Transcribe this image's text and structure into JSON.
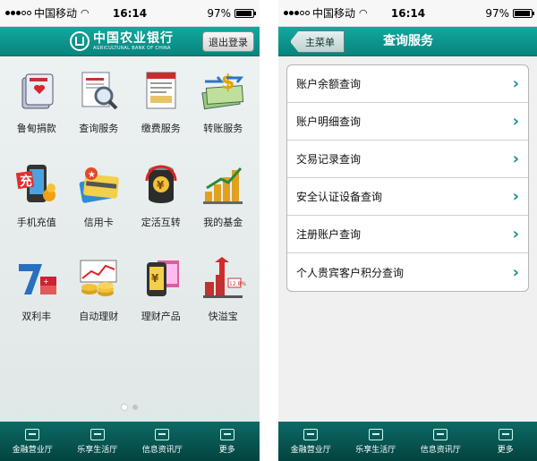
{
  "status_bar": {
    "carrier": "中国移动",
    "time": "16:14",
    "battery_text": "97%",
    "battery_level": 0.97
  },
  "left_screen": {
    "logo": {
      "cn": "中国农业银行",
      "en": "AGRICULTURAL BANK OF CHINA"
    },
    "logout_label": "退出登录",
    "grid": [
      {
        "label": "鲁甸捐款",
        "icon": "donation-box-icon"
      },
      {
        "label": "查询服务",
        "icon": "magnifier-query-icon"
      },
      {
        "label": "缴费服务",
        "icon": "pay-bill-icon"
      },
      {
        "label": "转账服务",
        "icon": "money-transfer-icon"
      },
      {
        "label": "手机充值",
        "icon": "phone-recharge-icon"
      },
      {
        "label": "信用卡",
        "icon": "credit-card-icon"
      },
      {
        "label": "定活互转",
        "icon": "currency-exchange-icon"
      },
      {
        "label": "我的基金",
        "icon": "fund-chart-icon"
      },
      {
        "label": "双利丰",
        "icon": "double-profit-icon"
      },
      {
        "label": "自动理财",
        "icon": "auto-finance-icon"
      },
      {
        "label": "理财产品",
        "icon": "finance-product-icon"
      },
      {
        "label": "快溢宝",
        "icon": "growth-bars-icon"
      }
    ],
    "pager": {
      "count": 2,
      "active": 1
    }
  },
  "right_screen": {
    "back_label": "主菜单",
    "title": "查询服务",
    "items": [
      {
        "label": "账户余额查询"
      },
      {
        "label": "账户明细查询"
      },
      {
        "label": "交易记录查询"
      },
      {
        "label": "安全认证设备查询"
      },
      {
        "label": "注册账户查询"
      },
      {
        "label": "个人贵宾客户积分查询"
      }
    ]
  },
  "tab_bar": [
    {
      "label": "金融营业厅",
      "icon": "bank-hall-icon"
    },
    {
      "label": "乐享生活厅",
      "icon": "life-hall-icon"
    },
    {
      "label": "信息资讯厅",
      "icon": "news-hall-icon"
    },
    {
      "label": "更多",
      "icon": "more-icon"
    }
  ],
  "colors": {
    "accent": "#0a948c",
    "tab_bar": "#04504c",
    "chevron": "#1a8e8a"
  }
}
